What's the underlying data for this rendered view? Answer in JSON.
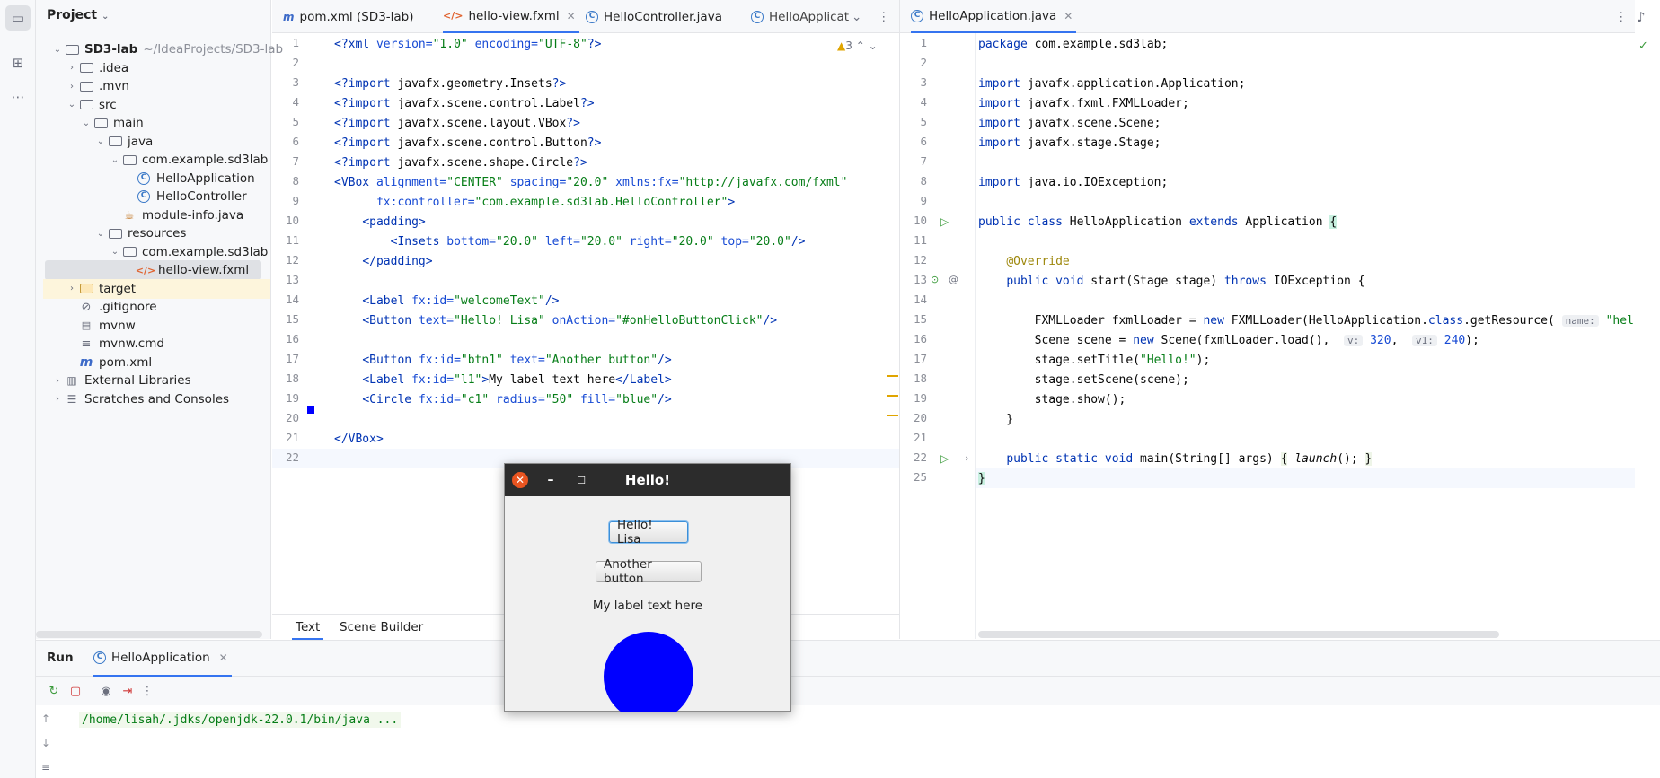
{
  "project": {
    "title": "Project",
    "tree": [
      {
        "label": "SD3-lab",
        "extra": "~/IdeaProjects/SD3-lab",
        "depth": 0,
        "chev": "v",
        "icon": "folder"
      },
      {
        "label": ".idea",
        "depth": 1,
        "chev": ">",
        "icon": "folder"
      },
      {
        "label": ".mvn",
        "depth": 1,
        "chev": ">",
        "icon": "folder"
      },
      {
        "label": "src",
        "depth": 1,
        "chev": "v",
        "icon": "folder"
      },
      {
        "label": "main",
        "depth": 2,
        "chev": "v",
        "icon": "folder"
      },
      {
        "label": "java",
        "depth": 3,
        "chev": "v",
        "icon": "folder"
      },
      {
        "label": "com.example.sd3lab",
        "depth": 4,
        "chev": "v",
        "icon": "package"
      },
      {
        "label": "HelloApplication",
        "depth": 5,
        "chev": "",
        "icon": "class"
      },
      {
        "label": "HelloController",
        "depth": 5,
        "chev": "",
        "icon": "class"
      },
      {
        "label": "module-info.java",
        "depth": 4,
        "chev": "",
        "icon": "module"
      },
      {
        "label": "resources",
        "depth": 3,
        "chev": "v",
        "icon": "folder"
      },
      {
        "label": "com.example.sd3lab",
        "depth": 4,
        "chev": "v",
        "icon": "folder"
      },
      {
        "label": "hello-view.fxml",
        "depth": 5,
        "chev": "",
        "icon": "fxml"
      },
      {
        "label": "target",
        "depth": 1,
        "chev": ">",
        "icon": "folder-target"
      },
      {
        "label": ".gitignore",
        "depth": 1,
        "chev": "",
        "icon": "ignore"
      },
      {
        "label": "mvnw",
        "depth": 1,
        "chev": "",
        "icon": "file"
      },
      {
        "label": "mvnw.cmd",
        "depth": 1,
        "chev": "",
        "icon": "lines"
      },
      {
        "label": "pom.xml",
        "depth": 1,
        "chev": "",
        "icon": "maven"
      },
      {
        "label": "External Libraries",
        "depth": 0,
        "chev": ">",
        "icon": "library"
      },
      {
        "label": "Scratches and Consoles",
        "depth": 0,
        "chev": ">",
        "icon": "scratch"
      }
    ]
  },
  "tabs_left": [
    {
      "label": "pom.xml (SD3-lab)",
      "icon": "m"
    },
    {
      "label": "hello-view.fxml",
      "icon": "</>",
      "close": "✕"
    },
    {
      "label": "HelloController.java",
      "icon": "C"
    },
    {
      "label": "HelloApplicat",
      "icon": "C"
    }
  ],
  "tabs_right": [
    {
      "label": "HelloApplication.java",
      "icon": "C",
      "close": "✕"
    }
  ],
  "fxml_lines": [
    "1",
    "2",
    "3",
    "4",
    "5",
    "6",
    "7",
    "8",
    "9",
    "10",
    "11",
    "12",
    "13",
    "14",
    "15",
    "16",
    "17",
    "18",
    "19",
    "20",
    "21",
    "22"
  ],
  "fxml_warning": "3",
  "java_lines": [
    "1",
    "2",
    "3",
    "4",
    "5",
    "6",
    "7",
    "8",
    "9",
    "10",
    "11",
    "12",
    "13",
    "14",
    "15",
    "16",
    "17",
    "18",
    "19",
    "20",
    "21",
    "22",
    "25"
  ],
  "editor_bottom_tabs": {
    "text": "Text",
    "scene_builder": "Scene Builder"
  },
  "run": {
    "title": "Run",
    "tab": "HelloApplication",
    "console": "/home/lisah/.jdks/openjdk-22.0.1/bin/java ..."
  },
  "app_window": {
    "title": "Hello!",
    "button1": "Hello! Lisa",
    "button2": "Another button",
    "label": "My label text here",
    "circle_color": "#0000ff"
  }
}
